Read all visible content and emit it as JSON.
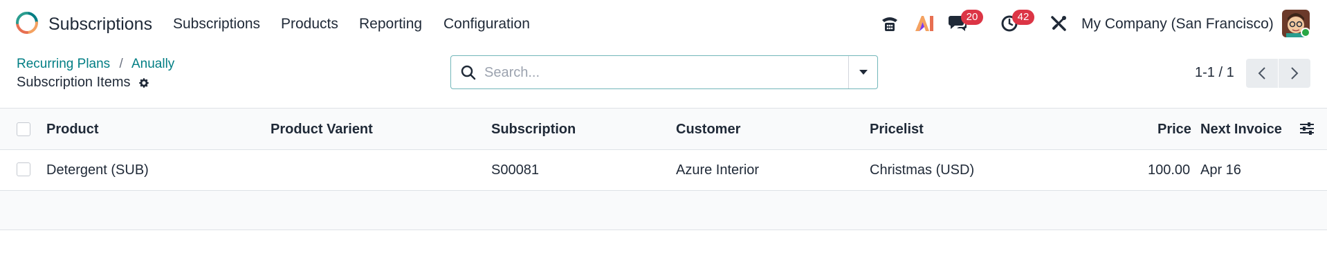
{
  "app": {
    "name": "Subscriptions",
    "logo_icon": "subscriptions-logo-icon"
  },
  "menu": [
    {
      "label": "Subscriptions"
    },
    {
      "label": "Products"
    },
    {
      "label": "Reporting"
    },
    {
      "label": "Configuration"
    }
  ],
  "systray": {
    "phone_icon": "phone-icon",
    "ai_icon": "ai-icon",
    "messages_icon": "chat-icon",
    "messages_count": "20",
    "activities_icon": "clock-icon",
    "activities_count": "42",
    "debug_icon": "tools-icon",
    "company": "My Company (San Francisco)",
    "badge_color": "#dc3545"
  },
  "breadcrumb": {
    "items": [
      "Recurring Plans",
      "Anually"
    ],
    "separator": "/"
  },
  "view": {
    "title": "Subscription Items",
    "settings_icon": "gear-icon"
  },
  "search": {
    "placeholder": "Search...",
    "value": ""
  },
  "pager": {
    "value": "1-1 / 1"
  },
  "table": {
    "columns": [
      "Product",
      "Product Varient",
      "Subscription",
      "Customer",
      "Pricelist",
      "Price",
      "Next Invoice"
    ],
    "rows": [
      {
        "product": "Detergent (SUB)",
        "variant": "",
        "subscription": "S00081",
        "customer": "Azure Interior",
        "pricelist": "Christmas (USD)",
        "price": "100.00",
        "next_invoice": "Apr 16"
      }
    ]
  },
  "colors": {
    "accent": "#017e84",
    "search_border": "#71b6b9",
    "header_bg": "#f9fafb"
  }
}
